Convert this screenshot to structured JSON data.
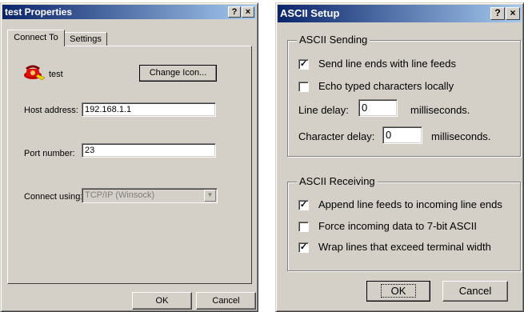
{
  "left_window": {
    "title": "test Properties",
    "help_btn": "?",
    "close_btn": "×",
    "tabs": [
      "Connect To",
      "Settings"
    ],
    "connection_name": "test",
    "change_icon_label": "Change Icon...",
    "host_label": "Host address:",
    "host_value": "192.168.1.1",
    "port_label": "Port number:",
    "port_value": "23",
    "connect_label": "Connect using:",
    "connect_value": "TCP/IP (Winsock)",
    "ok_label": "OK",
    "cancel_label": "Cancel"
  },
  "right_window": {
    "title": "ASCII Setup",
    "help_btn": "?",
    "close_btn": "×",
    "sending_legend": "ASCII Sending",
    "send_line_ends": "Send line ends with line feeds",
    "send_line_ends_checked": true,
    "echo_chars": "Echo typed characters locally",
    "echo_chars_checked": false,
    "line_delay_label": "Line delay:",
    "line_delay_value": "0",
    "line_delay_unit": "milliseconds.",
    "char_delay_label": "Character delay:",
    "char_delay_value": "0",
    "char_delay_unit": "milliseconds.",
    "receiving_legend": "ASCII Receiving",
    "append_lf": "Append line feeds to incoming line ends",
    "append_lf_checked": true,
    "force_7bit": "Force incoming data to 7-bit ASCII",
    "force_7bit_checked": false,
    "wrap_lines": "Wrap lines that exceed terminal width",
    "wrap_lines_checked": true,
    "ok_label": "OK",
    "cancel_label": "Cancel"
  }
}
